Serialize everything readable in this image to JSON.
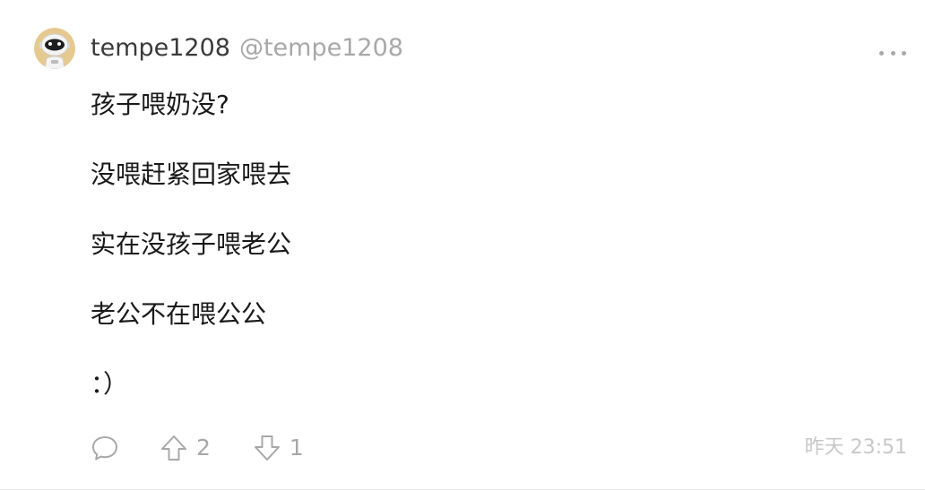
{
  "post": {
    "author": {
      "name": "tempe1208",
      "handle": "@tempe1208"
    },
    "body_lines": [
      "孩子喂奶没?",
      "没喂赶紧回家喂去",
      "实在没孩子喂老公",
      "老公不在喂公公",
      "：）"
    ],
    "actions": {
      "comment_icon": "comment-bubble-icon",
      "upvote_icon": "arrow-up-icon",
      "upvote_count": "2",
      "downvote_icon": "arrow-down-icon",
      "downvote_count": "1"
    },
    "timestamp": "昨天 23:51",
    "more_icon": "more-dots-icon"
  },
  "colors": {
    "background": "#ffffff",
    "text": "#1a1a1a",
    "muted": "#a8a8a8",
    "timestamp": "#c8c8c8",
    "avatar_bg": "#e6c98f"
  }
}
